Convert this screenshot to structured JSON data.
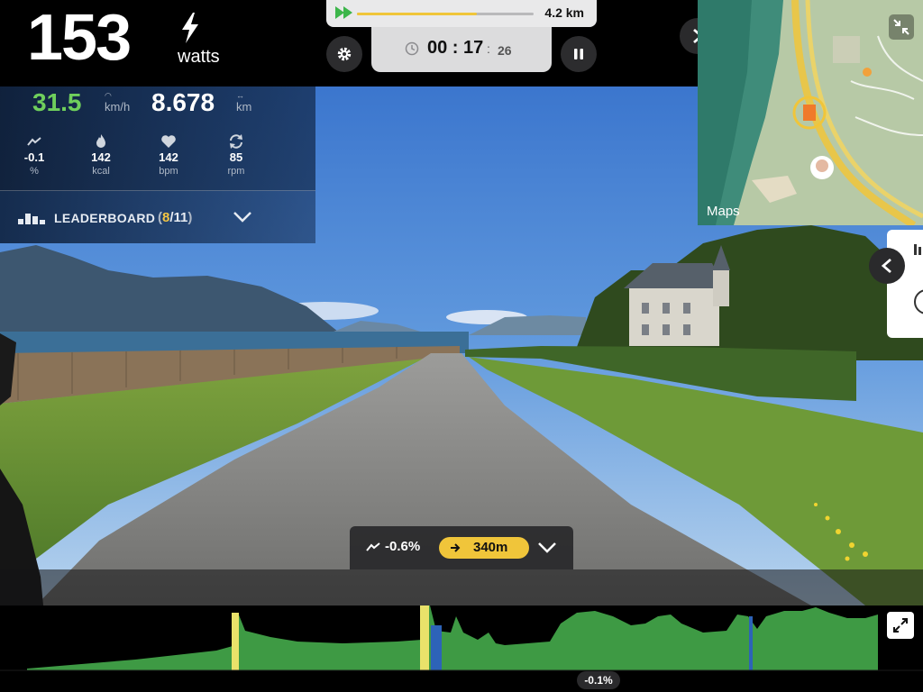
{
  "power": {
    "value": "153",
    "unit": "watts",
    "icon": "bolt-icon"
  },
  "speed": {
    "value": "31.5",
    "unit": "km/h",
    "color": "#6fcf5c"
  },
  "distance": {
    "value": "8.678",
    "unit": "km"
  },
  "metrics": [
    {
      "icon": "incline-icon",
      "value": "-0.1",
      "unit": "%"
    },
    {
      "icon": "flame-icon",
      "value": "142",
      "unit": "kcal"
    },
    {
      "icon": "heart-icon",
      "value": "142",
      "unit": "bpm"
    },
    {
      "icon": "cadence-icon",
      "value": "85",
      "unit": "rpm"
    }
  ],
  "leaderboard": {
    "label": "LEADERBOARD",
    "open": "(",
    "position": "8",
    "sep": "/",
    "total": "11",
    "close": ")"
  },
  "route": {
    "total": "4.2 km",
    "progress_fraction": 0.68
  },
  "timer": {
    "hours_minutes": "00 : 17",
    "colon": ":",
    "seconds": "26"
  },
  "map": {
    "label": "Maps"
  },
  "grade_indicator": {
    "value": "-0.6%",
    "distance_ahead": "340m"
  },
  "elevation": {
    "current_grade": "-0.1%"
  },
  "colors": {
    "accent": "#f0c53a",
    "profile_fill": "#3e9a44",
    "speed": "#6fcf5c"
  }
}
